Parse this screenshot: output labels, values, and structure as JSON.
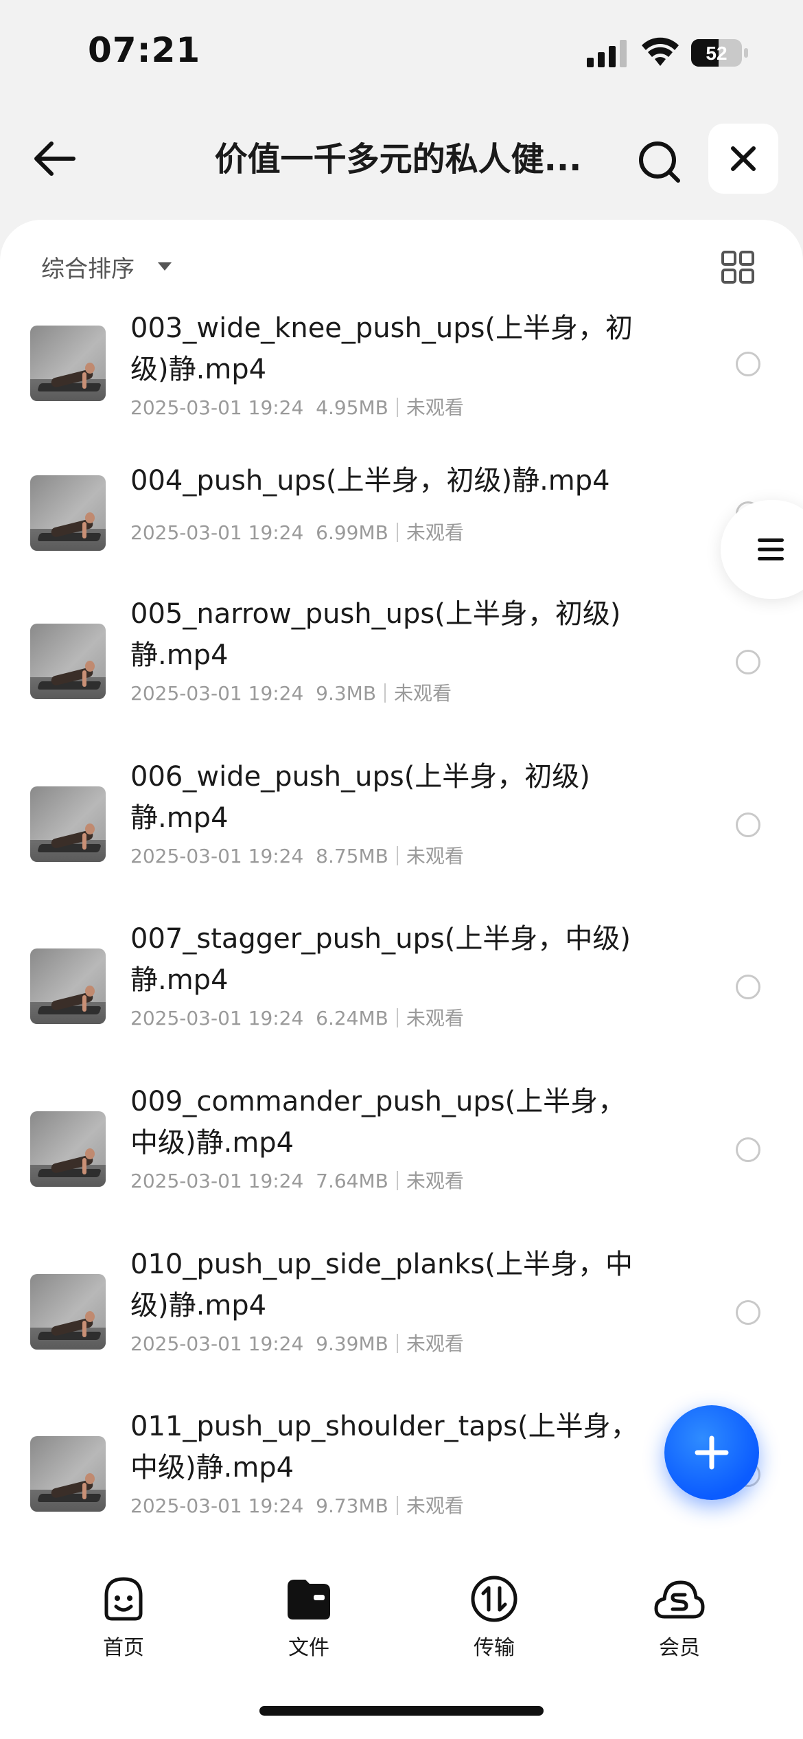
{
  "status_bar": {
    "time": "07:21",
    "battery": "52",
    "icons": [
      "cellular-signal-icon",
      "wifi-icon",
      "battery-icon"
    ]
  },
  "header": {
    "title": "价值一千多元的私人健...",
    "icons": [
      "back-arrow-icon",
      "search-icon",
      "close-icon"
    ]
  },
  "sort": {
    "label": "综合排序",
    "icons": [
      "caret-down-icon",
      "grid-view-icon"
    ]
  },
  "files": [
    {
      "name": "003_wide_knee_push_ups(上半身，初级)静.mp4",
      "date": "2025-03-01 19:24",
      "size": "4.95MB",
      "status": "未观看"
    },
    {
      "name": "004_push_ups(上半身，初级)静.mp4",
      "date": "2025-03-01 19:24",
      "size": "6.99MB",
      "status": "未观看"
    },
    {
      "name": "005_narrow_push_ups(上半身，初级)静.mp4",
      "date": "2025-03-01 19:24",
      "size": "9.3MB",
      "status": "未观看"
    },
    {
      "name": "006_wide_push_ups(上半身，初级)静.mp4",
      "date": "2025-03-01 19:24",
      "size": "8.75MB",
      "status": "未观看"
    },
    {
      "name": "007_stagger_push_ups(上半身，中级)静.mp4",
      "date": "2025-03-01 19:24",
      "size": "6.24MB",
      "status": "未观看"
    },
    {
      "name": "009_commander_push_ups(上半身，中级)静.mp4",
      "date": "2025-03-01 19:24",
      "size": "7.64MB",
      "status": "未观看"
    },
    {
      "name": "010_push_up_side_planks(上半身，中级)静.mp4",
      "date": "2025-03-01 19:24",
      "size": "9.39MB",
      "status": "未观看"
    },
    {
      "name": "011_push_up_shoulder_taps(上半身，中级)静.mp4",
      "date": "2025-03-01 19:24",
      "size": "9.73MB",
      "status": "未观看"
    }
  ],
  "floating": {
    "side_icon": "menu-lines-icon",
    "fab_icon": "plus-icon"
  },
  "bottom_nav": [
    {
      "label": "首页",
      "icon": "smiley-home-icon"
    },
    {
      "label": "文件",
      "icon": "folder-icon"
    },
    {
      "label": "传输",
      "icon": "transfer-icon"
    },
    {
      "label": "会员",
      "icon": "cloud-vip-icon"
    }
  ],
  "colors": {
    "accent": "#0b5cff",
    "background": "#f2f2f2",
    "meta_text": "#9a9a9a"
  }
}
